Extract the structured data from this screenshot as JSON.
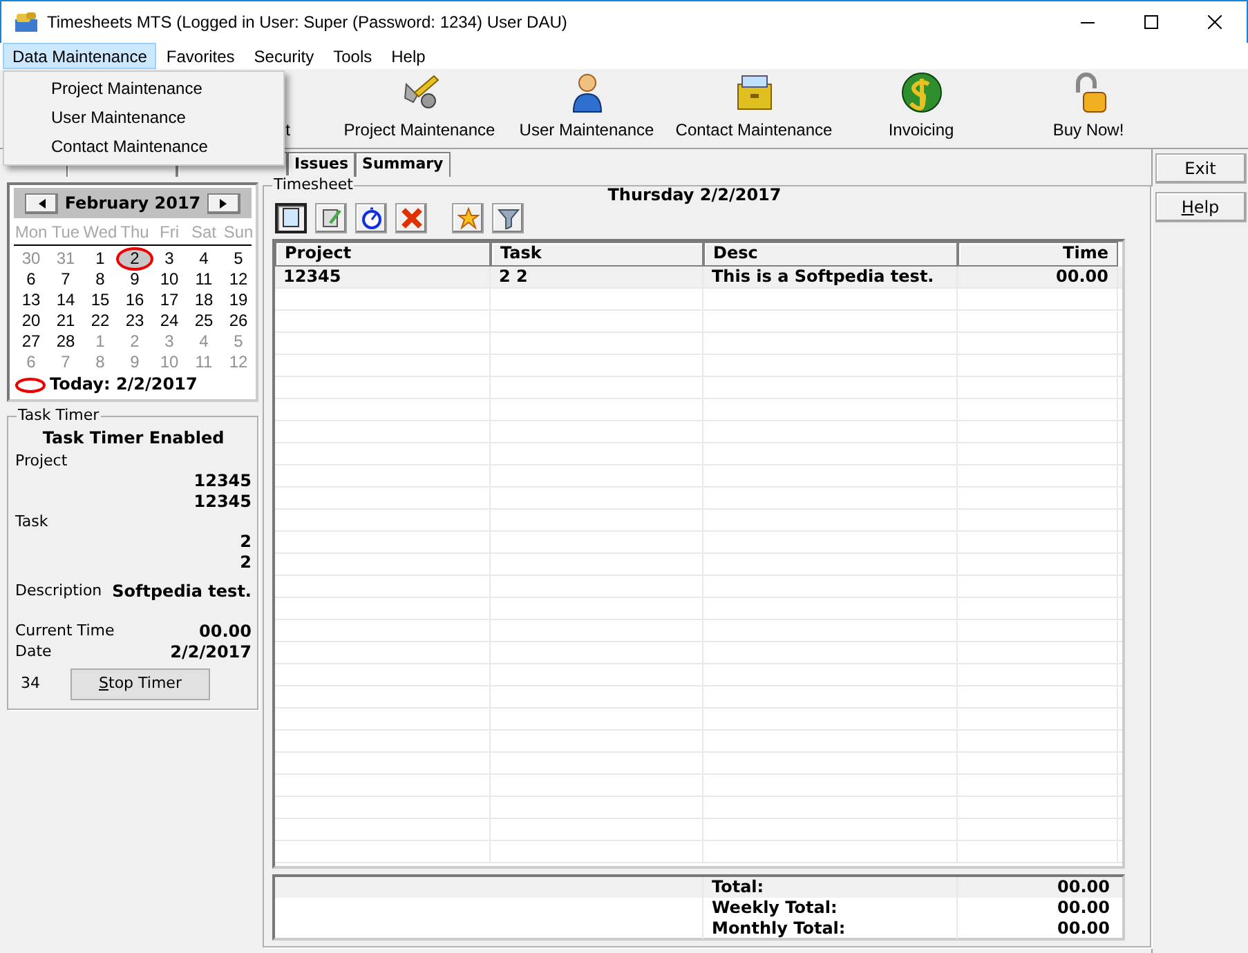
{
  "window": {
    "title": "Timesheets MTS (Logged in User: Super (Password: 1234) User DAU)"
  },
  "menu": [
    {
      "label": "Data Maintenance",
      "selected": true
    },
    {
      "label": "Favorites",
      "selected": false
    },
    {
      "label": "Security",
      "selected": false
    },
    {
      "label": "Tools",
      "selected": false
    },
    {
      "label": "Help",
      "selected": false
    }
  ],
  "open_menu": {
    "items": [
      "Project Maintenance",
      "User Maintenance",
      "Contact Maintenance"
    ]
  },
  "toolbar": {
    "partial_label": "t",
    "buttons": [
      {
        "label": "Project Maintenance",
        "kind": "tools"
      },
      {
        "label": "User Maintenance",
        "kind": "user"
      },
      {
        "label": "Contact Maintenance",
        "kind": "drawer"
      },
      {
        "label": "Invoicing",
        "kind": "coin"
      },
      {
        "label": "Buy Now!",
        "kind": "lock"
      }
    ]
  },
  "tabs": [
    {
      "label": "Issues"
    },
    {
      "label": "Summary"
    }
  ],
  "calendar": {
    "month": "February 2017",
    "weekdays": [
      "Mon",
      "Tue",
      "Wed",
      "Thu",
      "Fri",
      "Sat",
      "Sun"
    ],
    "weeks": [
      [
        {
          "day": "30",
          "other_month": true,
          "selected": false
        },
        {
          "day": "31",
          "other_month": true,
          "selected": false
        },
        {
          "day": "1",
          "other_month": false,
          "selected": false
        },
        {
          "day": "2",
          "other_month": false,
          "selected": true
        },
        {
          "day": "3",
          "other_month": false,
          "selected": false
        },
        {
          "day": "4",
          "other_month": false,
          "selected": false
        },
        {
          "day": "5",
          "other_month": false,
          "selected": false
        }
      ],
      [
        {
          "day": "6",
          "other_month": false,
          "selected": false
        },
        {
          "day": "7",
          "other_month": false,
          "selected": false
        },
        {
          "day": "8",
          "other_month": false,
          "selected": false
        },
        {
          "day": "9",
          "other_month": false,
          "selected": false
        },
        {
          "day": "10",
          "other_month": false,
          "selected": false
        },
        {
          "day": "11",
          "other_month": false,
          "selected": false
        },
        {
          "day": "12",
          "other_month": false,
          "selected": false
        }
      ],
      [
        {
          "day": "13",
          "other_month": false,
          "selected": false
        },
        {
          "day": "14",
          "other_month": false,
          "selected": false
        },
        {
          "day": "15",
          "other_month": false,
          "selected": false
        },
        {
          "day": "16",
          "other_month": false,
          "selected": false
        },
        {
          "day": "17",
          "other_month": false,
          "selected": false
        },
        {
          "day": "18",
          "other_month": false,
          "selected": false
        },
        {
          "day": "19",
          "other_month": false,
          "selected": false
        }
      ],
      [
        {
          "day": "20",
          "other_month": false,
          "selected": false
        },
        {
          "day": "21",
          "other_month": false,
          "selected": false
        },
        {
          "day": "22",
          "other_month": false,
          "selected": false
        },
        {
          "day": "23",
          "other_month": false,
          "selected": false
        },
        {
          "day": "24",
          "other_month": false,
          "selected": false
        },
        {
          "day": "25",
          "other_month": false,
          "selected": false
        },
        {
          "day": "26",
          "other_month": false,
          "selected": false
        }
      ],
      [
        {
          "day": "27",
          "other_month": false,
          "selected": false
        },
        {
          "day": "28",
          "other_month": false,
          "selected": false
        },
        {
          "day": "1",
          "other_month": true,
          "selected": false
        },
        {
          "day": "2",
          "other_month": true,
          "selected": false
        },
        {
          "day": "3",
          "other_month": true,
          "selected": false
        },
        {
          "day": "4",
          "other_month": true,
          "selected": false
        },
        {
          "day": "5",
          "other_month": true,
          "selected": false
        }
      ],
      [
        {
          "day": "6",
          "other_month": true,
          "selected": false
        },
        {
          "day": "7",
          "other_month": true,
          "selected": false
        },
        {
          "day": "8",
          "other_month": true,
          "selected": false
        },
        {
          "day": "9",
          "other_month": true,
          "selected": false
        },
        {
          "day": "10",
          "other_month": true,
          "selected": false
        },
        {
          "day": "11",
          "other_month": true,
          "selected": false
        },
        {
          "day": "12",
          "other_month": true,
          "selected": false
        }
      ]
    ],
    "today": "Today: 2/2/2017"
  },
  "task_timer": {
    "title": "Task Timer",
    "status": "Task Timer Enabled",
    "rows": [
      {
        "label": "Project",
        "values": [
          "12345",
          "12345"
        ]
      },
      {
        "label": "Task",
        "values": [
          "2",
          "2"
        ]
      },
      {
        "label": "Description",
        "value": "Softpedia test."
      },
      {
        "label": "Current Time",
        "value": "00.00"
      },
      {
        "label": "Date",
        "value": "2/2/2017"
      }
    ],
    "counter": "34",
    "button": "Stop Timer"
  },
  "timesheet": {
    "title": "Timesheet",
    "date": "Thursday 2/2/2017",
    "tools": [
      {
        "kind": "new",
        "pressed": true
      },
      {
        "kind": "edit",
        "pressed": false
      },
      {
        "kind": "timer",
        "pressed": false
      },
      {
        "kind": "delete",
        "pressed": false
      },
      {
        "kind": "star",
        "pressed": false
      },
      {
        "kind": "filter",
        "pressed": false
      }
    ],
    "table": {
      "columns": [
        "Project",
        "Task",
        "Desc",
        "Time"
      ],
      "rows": [
        [
          "12345",
          "2 2",
          "This is a Softpedia test.",
          "00.00"
        ]
      ]
    },
    "totals": [
      {
        "label": "Total:",
        "value": "00.00"
      },
      {
        "label": "Weekly Total:",
        "value": "00.00"
      },
      {
        "label": "Monthly Total:",
        "value": "00.00"
      }
    ]
  },
  "side_buttons": [
    "Exit",
    "Help"
  ]
}
